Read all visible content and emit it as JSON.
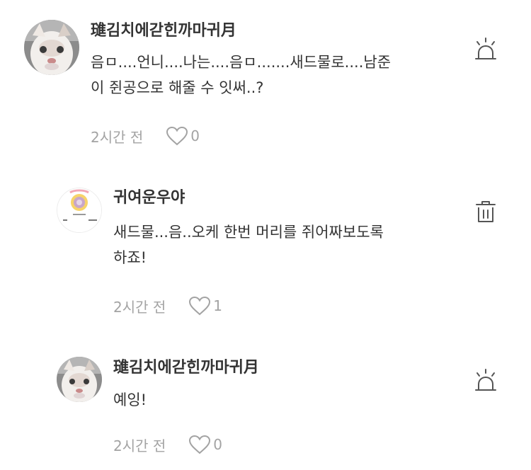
{
  "comments": [
    {
      "author": "璡김치에갇힌까마귀月",
      "text": "음ㅁ....언니....나는....음ㅁ.......새드물로....남준\n이 쥔공으로 해줄 수 잇써..?",
      "time": "2시간 전",
      "likes": "0",
      "action_icon": "siren-icon"
    },
    {
      "author": "귀여운우야",
      "text": "새드물...음..오케 한번 머리를 쥐어짜보도록\n하죠!",
      "time": "2시간 전",
      "likes": "1",
      "action_icon": "trash-icon"
    },
    {
      "author": "璡김치에갇힌까마귀月",
      "text": "예잉!",
      "time": "2시간 전",
      "likes": "0",
      "action_icon": "siren-icon"
    }
  ],
  "colors": {
    "text": "#333333",
    "meta": "#a3a3a3",
    "icon": "#555555"
  }
}
